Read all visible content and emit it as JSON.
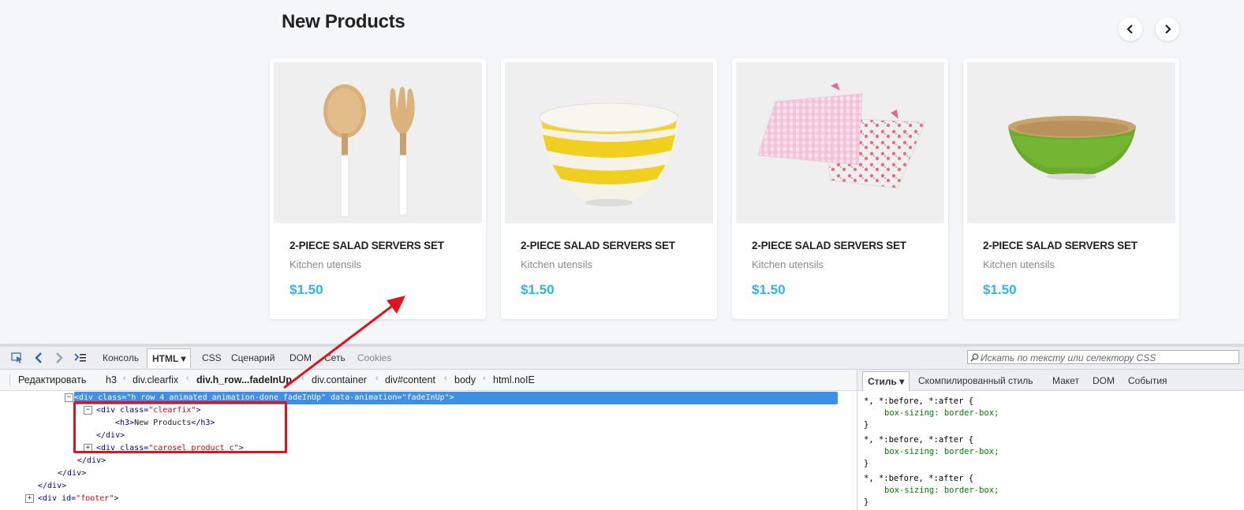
{
  "section_title": "New Products",
  "nav": {
    "prev_icon": "chevron-left-icon",
    "next_icon": "chevron-right-icon"
  },
  "products": [
    {
      "name": "2-PIECE SALAD SERVERS SET",
      "category": "Kitchen utensils",
      "price": "$1.50",
      "image": "salad-servers"
    },
    {
      "name": "2-PIECE SALAD SERVERS SET",
      "category": "Kitchen utensils",
      "price": "$1.50",
      "image": "yellow-striped-bowl"
    },
    {
      "name": "2-PIECE SALAD SERVERS SET",
      "category": "Kitchen utensils",
      "price": "$1.50",
      "image": "checked-towels"
    },
    {
      "name": "2-PIECE SALAD SERVERS SET",
      "category": "Kitchen utensils",
      "price": "$1.50",
      "image": "green-bowl"
    }
  ],
  "devtools": {
    "tabs": [
      "Консоль",
      "HTML",
      "CSS",
      "Сценарий",
      "DOM",
      "Сеть",
      "Cookies"
    ],
    "search_placeholder": "Искать по тексту или селектору CSS",
    "edit_label": "Редактировать",
    "breadcrumbs": [
      "h3",
      "div.clearfix",
      "div.h_row...fadeInUp",
      "div.container",
      "div#content",
      "body",
      "html.noIE"
    ],
    "side_tabs": [
      "Стиль",
      "Скомпилированный стиль",
      "Макет",
      "DOM",
      "События"
    ],
    "html_lines": [
      {
        "open": "<div ",
        "a1": "class=",
        "v1": "\"h_row_4 animated animation-done fadeInUp\"",
        "a2": " data-animation=",
        "v2": "\"fadeInUp\"",
        "close": ">"
      },
      {
        "open": "<div ",
        "a1": "class=",
        "v1": "\"clearfix\"",
        "close": ">"
      },
      {
        "open": "<h3>",
        "text": "New Products",
        "close": "</h3>"
      },
      {
        "close": "</div>"
      },
      {
        "open": "<div ",
        "a1": "class=",
        "v1": "\"carosel product_c\"",
        "close": ">"
      },
      {
        "close": "</div>"
      },
      {
        "close": "</div>"
      },
      {
        "close": "</div>"
      },
      {
        "open": "<div ",
        "a1": "id=",
        "v1": "\"footer\"",
        "close": ">"
      }
    ],
    "css_rules": [
      {
        "selector": "*, *:before, *:after {",
        "property": "box-sizing: border-box;",
        "end": "}"
      },
      {
        "selector": "*, *:before, *:after {",
        "property": "box-sizing: border-box;",
        "end": "}"
      },
      {
        "selector": "*, *:before, *:after {",
        "property": "box-sizing: border-box;",
        "end": "}"
      }
    ]
  },
  "colors": {
    "accent_price": "#2fb4e8",
    "annotation_red": "#e0141e",
    "selection_blue": "#3d8fe8"
  }
}
